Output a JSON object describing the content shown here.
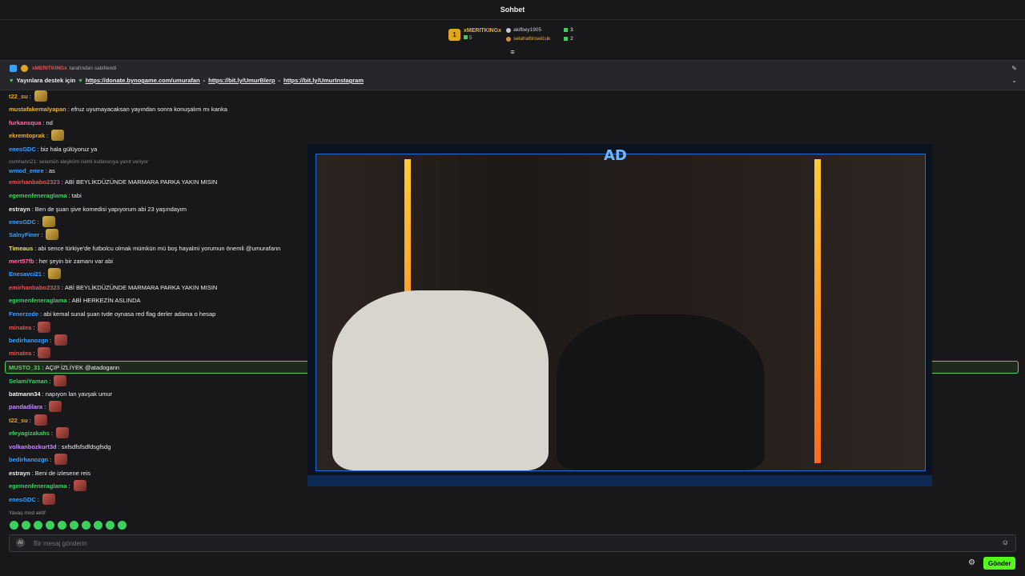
{
  "header": {
    "title": "Sohbet"
  },
  "leaderboard": {
    "top": {
      "rank": "1",
      "name": "xMERITKINGx",
      "score": "5"
    },
    "second": {
      "name": "akifbey1905",
      "score": "3"
    },
    "third": {
      "name": "selahattinselcuk",
      "score": "2"
    }
  },
  "pinned": {
    "author": "xMERITKINGx",
    "pinned_by": "tarafından sabitlendi",
    "lead": "Yayınlara destek için",
    "links": [
      "https://donate.bynogame.com/umurafan",
      "https://bit.ly/UmurBlerp",
      "https://bit.ly/UmurInstagram"
    ],
    "sep": "-"
  },
  "messages": [
    {
      "user": "t22_su",
      "color": "#e0a623",
      "text": "",
      "emote": "gold"
    },
    {
      "user": "mustafakemalyapan",
      "color": "#e8b13c",
      "text": "efruz uyumayacaksan yayından sonra konuşalım mı kanka"
    },
    {
      "user": "furkansqua",
      "color": "#ff6fa8",
      "text": "nd"
    },
    {
      "user": "ekremtoprak",
      "color": "#e8b13c",
      "text": "",
      "emote": "gold"
    },
    {
      "user": "enesGDC",
      "color": "#3aa0ff",
      "text": "biz hala gülüyoruz ya"
    },
    {
      "user": "wmod_emre",
      "color": "#3aa0ff",
      "text": "as",
      "reply": "osmhann21: selamün aleyküm isimli kullanıcıya yanıt veriyor"
    },
    {
      "user": "emirhanbabo2323",
      "color": "#e05555",
      "text": "ABİ BEYLİKDÜZÜNDE MARMARA PARKA YAKIN MISIN"
    },
    {
      "user": "egemenfeneraglama",
      "color": "#3cd15c",
      "text": "tabi"
    },
    {
      "user": "estrayn",
      "color": "#efeff1",
      "text": "Ben de şuan şive komedisi yapıyorum abi 23 yaşındayım"
    },
    {
      "user": "enesGDC",
      "color": "#3aa0ff",
      "text": "",
      "emote": "gold"
    },
    {
      "user": "SalnyFiner",
      "color": "#3aa0ff",
      "text": "",
      "emote": "gold"
    },
    {
      "user": "Timeaus",
      "color": "#e8e05a",
      "text": "abi sence türkiye'de futbolcu olmak mümkün mü boş hayalmi yorumun önemli @umurafann"
    },
    {
      "user": "mert57fb",
      "color": "#ff6fa8",
      "text": "her şeyin bir zamanı var abi"
    },
    {
      "user": "Enesavci21",
      "color": "#3aa0ff",
      "text": "",
      "emote": "gold"
    },
    {
      "user": "emirhanbabo2323",
      "color": "#e05555",
      "text": "ABİ BEYLİKDÜZÜNDE MARMARA PARKA YAKIN MISIN"
    },
    {
      "user": "egemenfeneraglama",
      "color": "#3cd15c",
      "text": "ABİ HERKEZİN ASLINDA"
    },
    {
      "user": "Fenerzede",
      "color": "#3aa0ff",
      "text": "abi kemal sunal şuan tvde oynasa red flag derler adama o hesap"
    },
    {
      "user": "minatea",
      "color": "#e05555",
      "text": "",
      "emote": "red"
    },
    {
      "user": "bedirhanozgn",
      "color": "#3aa0ff",
      "text": "",
      "emote": "red"
    },
    {
      "user": "minatea",
      "color": "#e05555",
      "text": "",
      "emote": "red"
    },
    {
      "user": "MUSTO_31",
      "color": "#5ad15a",
      "text": "AÇIP İZLİYEK @atadogann"
    },
    {
      "user": "SelamiYaman",
      "color": "#3cd15c",
      "text": "",
      "emote": "red"
    },
    {
      "user": "batmann34",
      "color": "#efeff1",
      "text": "napıyon lan yavşak umur"
    },
    {
      "user": "pandadilara",
      "color": "#c98bff",
      "text": "",
      "emote": "red"
    },
    {
      "user": "t22_su",
      "color": "#e0a623",
      "text": "",
      "emote": "red"
    },
    {
      "user": "efeyagizakahs",
      "color": "#3cd15c",
      "text": "",
      "emote": "red"
    },
    {
      "user": "volkanbozkurt3d",
      "color": "#c98bff",
      "text": "sxfsdfsfsdfdsgfsdg"
    },
    {
      "user": "bedirhanozgn",
      "color": "#3aa0ff",
      "text": "",
      "emote": "red"
    },
    {
      "user": "estrayn",
      "color": "#efeff1",
      "text": "Beni de izlesene reis"
    },
    {
      "user": "egemenfeneraglama",
      "color": "#3cd15c",
      "text": "",
      "emote": "red"
    },
    {
      "user": "enesGDC",
      "color": "#3aa0ff",
      "text": "",
      "emote": "red"
    }
  ],
  "slow_mode": "Yavaş mod aktif",
  "input": {
    "placeholder": "Bir mesaj gönderin"
  },
  "send_label": "Gönder",
  "colors": {
    "accent": "#53fc18",
    "background": "#18181b"
  }
}
